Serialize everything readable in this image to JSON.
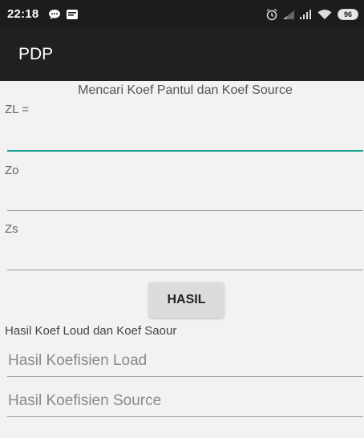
{
  "status": {
    "time": "22:18",
    "battery": "96",
    "icons": [
      "chat-bubble-icon",
      "notification-icon",
      "alarm-icon",
      "signal-low-icon",
      "signal-icon",
      "wifi-icon",
      "battery-icon"
    ]
  },
  "appbar": {
    "title": "PDP"
  },
  "form": {
    "heading": "Mencari Koef Pantul dan Koef Source",
    "zl_label": "ZL =",
    "zl_value": "",
    "zo_label": "Zo",
    "zo_value": "",
    "zs_label": "Zs",
    "zs_value": "",
    "button_label": "HASIL",
    "result_caption": "Hasil Koef Loud dan Koef Saour",
    "load_placeholder": "Hasil Koefisien Load",
    "source_placeholder": "Hasil Koefisien Source"
  },
  "colors": {
    "statusbar": "#1c1c1c",
    "appbar": "#202020",
    "background": "#f2f2f2",
    "accent": "#159d8f",
    "button": "#dcdcdc"
  }
}
